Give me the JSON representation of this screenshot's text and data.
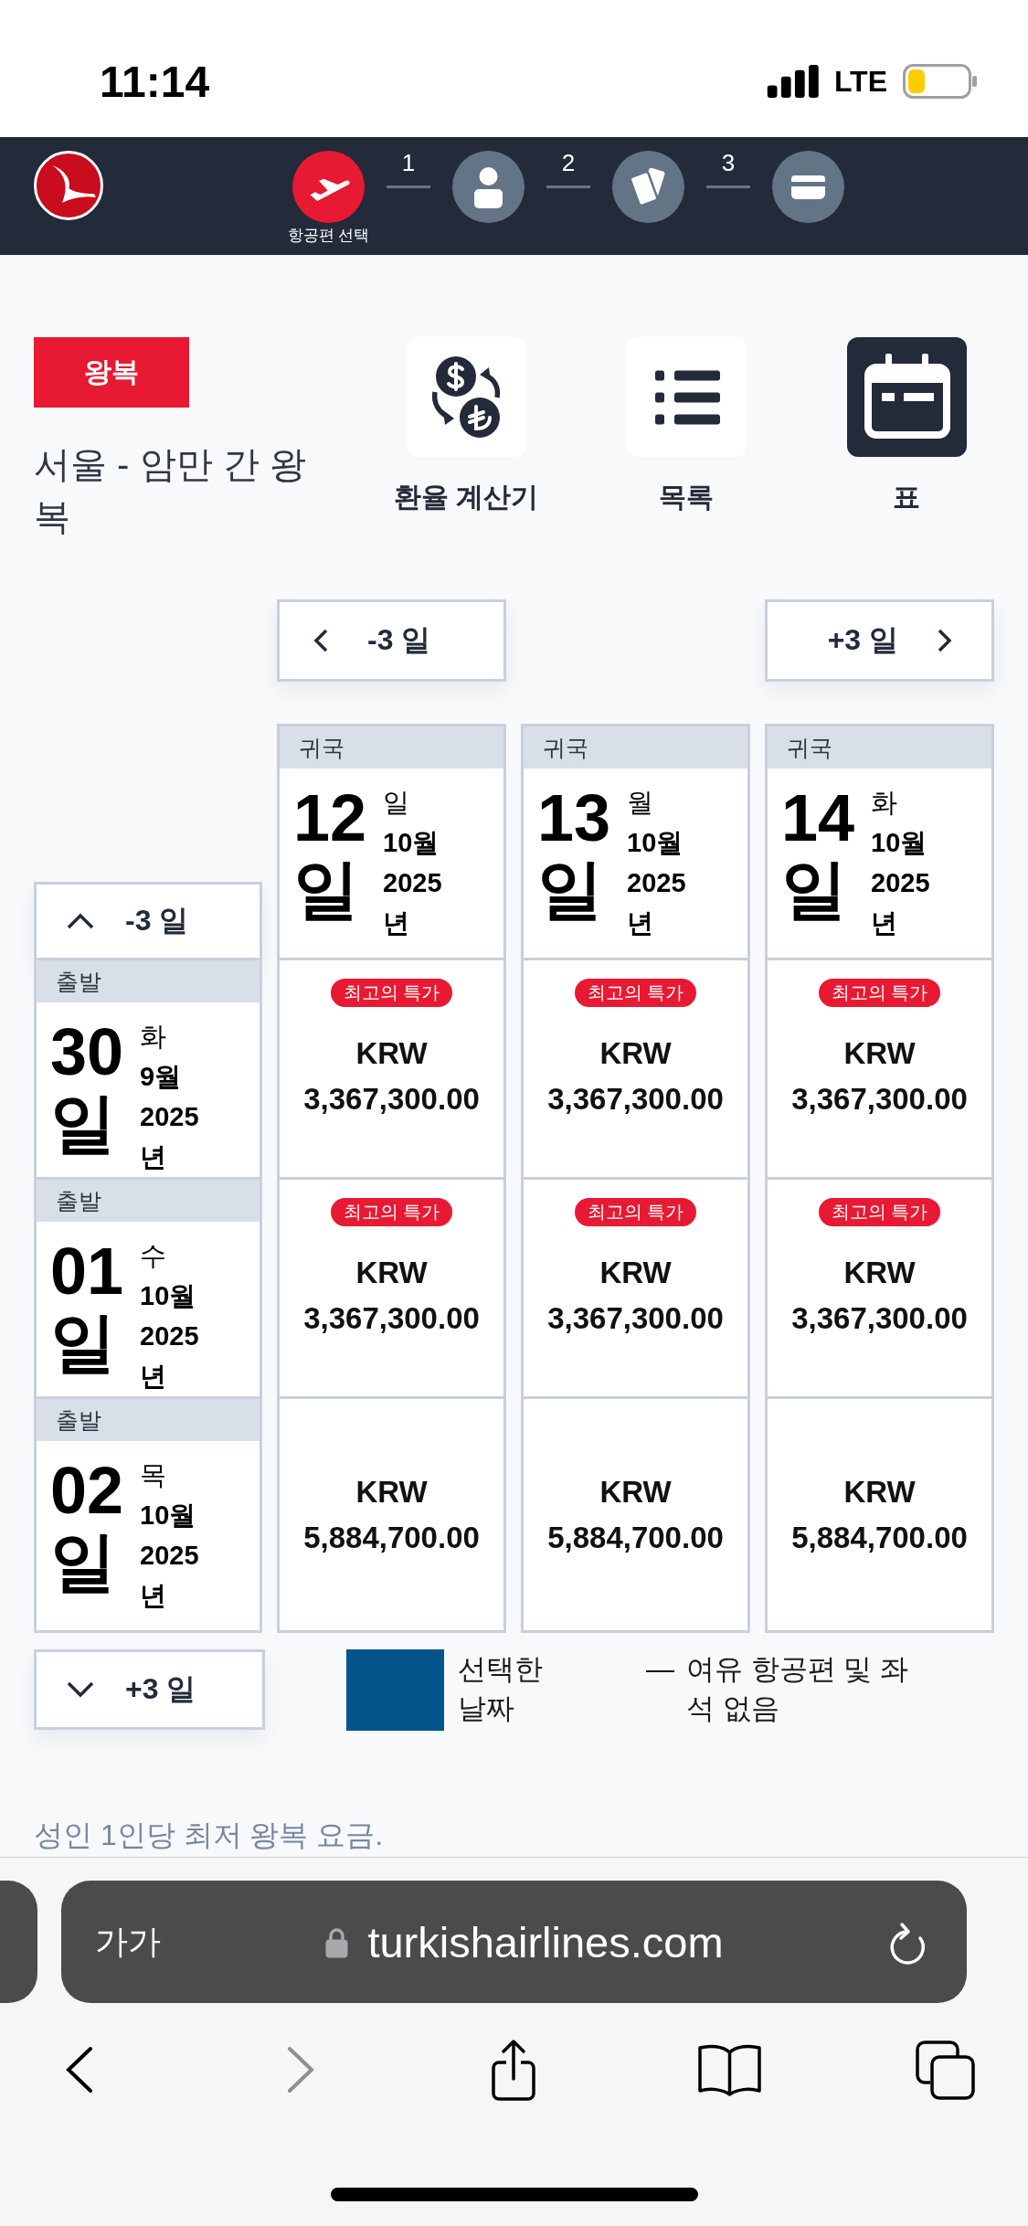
{
  "status_bar": {
    "time": "11:14",
    "network": "LTE"
  },
  "steps": [
    {
      "kind": "flight",
      "label": "항공편 선택",
      "selected": true
    },
    {
      "kind": "passenger",
      "number": "1",
      "selected": false
    },
    {
      "kind": "cards",
      "number": "2",
      "selected": false
    },
    {
      "kind": "payment",
      "number": "3",
      "selected": false
    }
  ],
  "trip_type": "왕복",
  "route_title": "서울 - 암만 간 왕복",
  "tools": [
    {
      "kind": "currency",
      "label": "환율 계산기",
      "selected": false
    },
    {
      "kind": "list",
      "label": "목록",
      "selected": false
    },
    {
      "kind": "table",
      "label": "표",
      "selected": true
    }
  ],
  "date_nav": {
    "previous": "-3 일",
    "next": "+3 일"
  },
  "return_dates": [
    {
      "label": "귀국",
      "day": "12 일",
      "weekday": "일",
      "month": "10월",
      "year": "2025 년"
    },
    {
      "label": "귀국",
      "day": "13 일",
      "weekday": "월",
      "month": "10월",
      "year": "2025 년"
    },
    {
      "label": "귀국",
      "day": "14 일",
      "weekday": "화",
      "month": "10월",
      "year": "2025 년"
    }
  ],
  "departure_rows": [
    {
      "label": "출발",
      "day": "30 일",
      "weekday": "화",
      "month": "9월",
      "year": "2025 년",
      "fares": [
        {
          "badge": "최고의 특가",
          "currency": "KRW",
          "amount": "3,367,300.00",
          "selected": false
        },
        {
          "badge": "최고의 특가",
          "currency": "KRW",
          "amount": "3,367,300.00",
          "selected": false
        },
        {
          "badge": "최고의 특가",
          "currency": "KRW",
          "amount": "3,367,300.00",
          "selected": false
        }
      ]
    },
    {
      "label": "출발",
      "day": "01 일",
      "weekday": "수",
      "month": "10월",
      "year": "2025 년",
      "fares": [
        {
          "badge": "최고의 특가",
          "currency": "KRW",
          "amount": "3,367,300.00",
          "selected": false
        },
        {
          "badge": "최고의 특가",
          "currency": "KRW",
          "amount": "3,367,300.00",
          "selected": false
        },
        {
          "badge": "최고의 특가",
          "currency": "KRW",
          "amount": "3,367,300.00",
          "selected": false
        }
      ]
    },
    {
      "label": "출발",
      "day": "02 일",
      "weekday": "목",
      "month": "10월",
      "year": "2025 년",
      "fares": [
        {
          "currency": "KRW",
          "amount": "5,884,700.00",
          "selected": false
        },
        {
          "currency": "KRW",
          "amount": "5,884,700.00",
          "selected": false
        },
        {
          "currency": "KRW",
          "amount": "5,884,700.00",
          "selected": false
        }
      ]
    }
  ],
  "row_nav": {
    "previous": "-3 일",
    "next": "+3 일"
  },
  "legend": [
    {
      "kind": "swatch",
      "color": "#02558b",
      "label": "선택한 날짜"
    },
    {
      "kind": "dash",
      "symbol": "—",
      "label": "여유 항공편 및 좌석 없음"
    }
  ],
  "footnote": "성인 1인당 최저 왕복 요금.",
  "browser": {
    "text_size": "가가",
    "url": "turkishairlines.com"
  }
}
